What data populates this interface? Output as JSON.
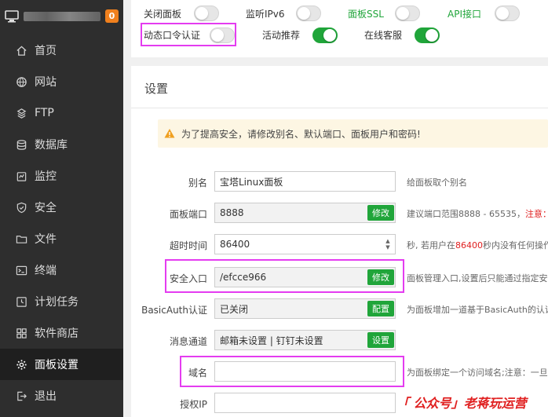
{
  "sidebar": {
    "badge": "0",
    "items": [
      {
        "label": "首页",
        "icon": "home-icon"
      },
      {
        "label": "网站",
        "icon": "globe-icon"
      },
      {
        "label": "FTP",
        "icon": "ftp-icon"
      },
      {
        "label": "数据库",
        "icon": "database-icon"
      },
      {
        "label": "监控",
        "icon": "monitor-icon"
      },
      {
        "label": "安全",
        "icon": "shield-icon"
      },
      {
        "label": "文件",
        "icon": "folder-icon"
      },
      {
        "label": "终端",
        "icon": "terminal-icon"
      },
      {
        "label": "计划任务",
        "icon": "clock-icon"
      },
      {
        "label": "软件商店",
        "icon": "store-icon"
      },
      {
        "label": "面板设置",
        "icon": "gear-icon"
      },
      {
        "label": "退出",
        "icon": "logout-icon"
      }
    ],
    "active": "面板设置"
  },
  "toggles": [
    {
      "label": "关闭面板",
      "on": false,
      "green": false
    },
    {
      "label": "监听IPv6",
      "on": false,
      "green": false
    },
    {
      "label": "面板SSL",
      "on": false,
      "green": true
    },
    {
      "label": "API接口",
      "on": false,
      "green": true
    },
    {
      "label": "动态口令认证",
      "on": false,
      "green": false
    },
    {
      "label": "活动推荐",
      "on": true,
      "green": false
    },
    {
      "label": "在线客服",
      "on": true,
      "green": false
    }
  ],
  "settings": {
    "title": "设置",
    "warning": "为了提高安全，请修改别名、默认端口、面板用户和密码!",
    "rows": [
      {
        "label": "别名",
        "value": "宝塔Linux面板",
        "button": "",
        "hint": "给面板取个别名"
      },
      {
        "label": "面板端口",
        "value": "8888",
        "button": "修改",
        "hint": "建议端口范围8888 - 65535，",
        "hint_red": "注意：有"
      },
      {
        "label": "超时时间",
        "value": "86400",
        "button": "",
        "hint": "秒, 若用户在",
        "hint_red": "86400",
        "hint_tail": "秒内没有任何操作"
      },
      {
        "label": "安全入口",
        "value": "/efcce966",
        "button": "修改",
        "hint": "面板管理入口,设置后只能通过指定安全"
      },
      {
        "label": "BasicAuth认证",
        "value": "已关闭",
        "button": "配置",
        "hint": "为面板增加一道基于BasicAuth的认证服"
      },
      {
        "label": "消息通道",
        "value": "邮箱未设置 | 钉钉未设置",
        "button": "设置",
        "hint": ""
      },
      {
        "label": "域名",
        "value": "",
        "button": "",
        "hint": "为面板绑定一个访问域名;注意：一旦绑"
      },
      {
        "label": "授权IP",
        "value": "",
        "button": "",
        "hint": ""
      }
    ]
  },
  "watermark": "「 公众号」老蒋玩运营",
  "colors": {
    "accent": "#20a53a",
    "highlight": "#e43cf0",
    "sidebar": "#2e2e2e"
  }
}
